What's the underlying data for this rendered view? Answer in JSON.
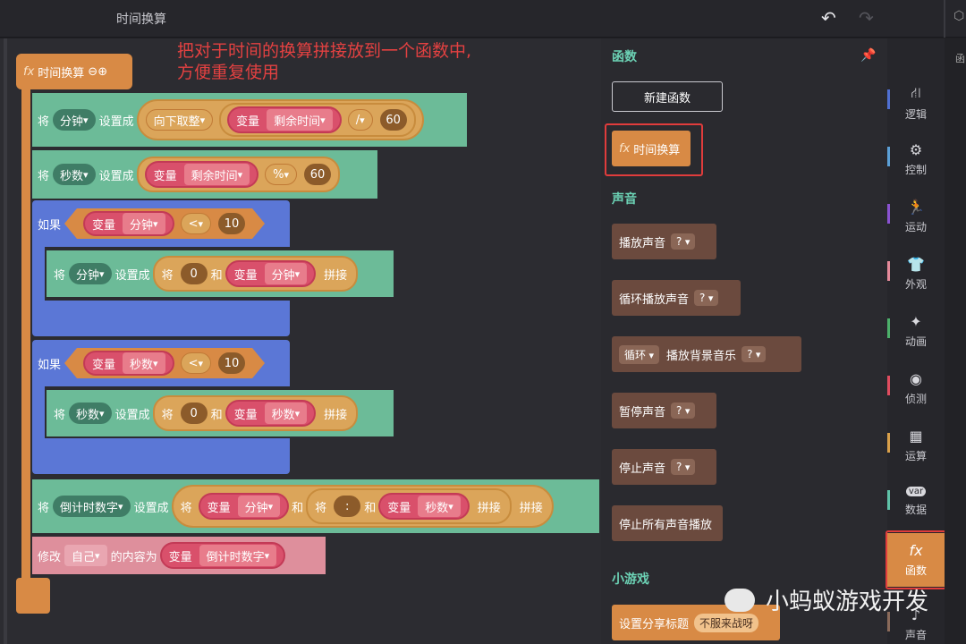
{
  "topbar": {
    "title": "时间换算",
    "undo_icon": "undo-icon",
    "redo_icon": "redo-icon"
  },
  "note": {
    "line1": "把对于时间的换算拼接放到一个函数中,",
    "line2": "方便重复使用"
  },
  "function_block": {
    "icon": "fx",
    "name": "时间换算",
    "minus": "⊖",
    "plus": "⊕"
  },
  "blocks": {
    "set_label": "将",
    "set_as": "设置成",
    "var_label": "变量",
    "row1": {
      "var": "分钟",
      "floor": "向下取整",
      "inner_var": "剩余时间",
      "op": "/",
      "num": "60"
    },
    "row2": {
      "var": "秒数",
      "inner_var": "剩余时间",
      "op": "%",
      "num": "60"
    },
    "if_label": "如果",
    "and_label": "和",
    "concat_label": "拼接",
    "if1": {
      "var": "分钟",
      "op": "<",
      "num": "10"
    },
    "set3": {
      "var": "分钟",
      "zero": "0",
      "inner_var": "分钟"
    },
    "if2": {
      "var": "秒数",
      "op": "<",
      "num": "10"
    },
    "set4": {
      "var": "秒数",
      "zero": "0",
      "inner_var": "秒数"
    },
    "row5": {
      "var": "倒计时数字",
      "var_a": "分钟",
      "colon": ":",
      "var_b": "秒数"
    },
    "row6": {
      "modify": "修改",
      "target": "自己",
      "content_as": "的内容为",
      "var": "倒计时数字"
    }
  },
  "palette": {
    "sections": {
      "functions": "函数",
      "sound": "声音",
      "minigame": "小游戏"
    },
    "new_function": "新建函数",
    "fn_item": "时间换算",
    "sound_items": [
      {
        "label": "播放声音",
        "dd": "?"
      },
      {
        "label": "循环播放声音",
        "dd": "?"
      },
      {
        "label": "播放背景音乐",
        "prefix": "循环",
        "dd": "?"
      },
      {
        "label": "暂停声音",
        "dd": "?"
      },
      {
        "label": "停止声音",
        "dd": "?"
      },
      {
        "label": "停止所有声音播放"
      }
    ],
    "share": {
      "label": "设置分享标题",
      "value": "不服来战呀"
    }
  },
  "categories": [
    {
      "label": "逻辑",
      "icon": "logic-icon",
      "color": "#4f6fd1"
    },
    {
      "label": "控制",
      "icon": "control-icon",
      "color": "#5b9fd6"
    },
    {
      "label": "运动",
      "icon": "motion-icon",
      "color": "#8a52d1"
    },
    {
      "label": "外观",
      "icon": "looks-icon",
      "color": "#e58a9a"
    },
    {
      "label": "动画",
      "icon": "animation-icon",
      "color": "#4caf6a"
    },
    {
      "label": "侦测",
      "icon": "sensing-icon",
      "color": "#e04c5f"
    },
    {
      "label": "运算",
      "icon": "operator-icon",
      "color": "#d9a04a"
    },
    {
      "label": "数据",
      "icon": "data-icon",
      "color": "#5fc2a8"
    },
    {
      "label": "函数",
      "icon": "function-icon",
      "color": "#d88a45"
    },
    {
      "label": "声音",
      "icon": "sound-icon",
      "color": "#8a6a5a"
    }
  ],
  "right_edge_label": "函",
  "watermark": "小蚂蚁游戏开发"
}
